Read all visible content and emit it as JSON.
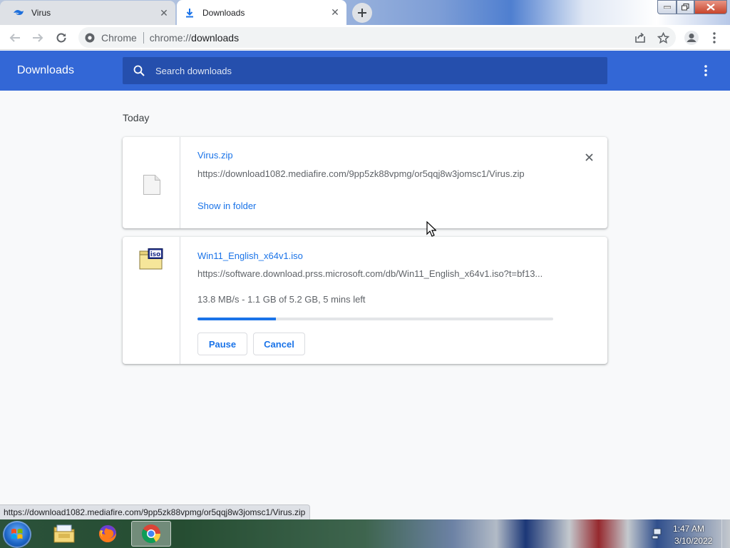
{
  "tabs": [
    {
      "title": "Virus",
      "active": false
    },
    {
      "title": "Downloads",
      "active": true
    }
  ],
  "omnibox": {
    "site_label": "Chrome",
    "url_scheme": "chrome://",
    "url_host": "downloads"
  },
  "header": {
    "title": "Downloads",
    "search_placeholder": "Search downloads"
  },
  "section": {
    "label": "Today"
  },
  "downloads": [
    {
      "name": "Virus.zip",
      "url": "https://download1082.mediafire.com/9pp5zk88vpmg/or5qqj8w3jomsc1/Virus.zip",
      "action": "Show in folder",
      "icon": "generic-file-icon"
    },
    {
      "name": "Win11_English_x64v1.iso",
      "url": "https://software.download.prss.microsoft.com/db/Win11_English_x64v1.iso?t=bf13...",
      "status": "13.8 MB/s - 1.1 GB of 5.2 GB, 5 mins left",
      "progress": 0.22,
      "pause_label": "Pause",
      "cancel_label": "Cancel",
      "icon": "iso-file-icon"
    }
  ],
  "status_bubble": "https://download1082.mediafire.com/9pp5zk88vpmg/or5qqj8w3jomsc1/Virus.zip",
  "taskbar": {
    "apps": [
      "windows-explorer",
      "firefox",
      "chrome"
    ],
    "time": "1:47 AM",
    "date": "3/10/2022"
  },
  "colors": {
    "header_blue": "#3367d6",
    "link_blue": "#1a73e8",
    "search_bg": "#254fad"
  }
}
